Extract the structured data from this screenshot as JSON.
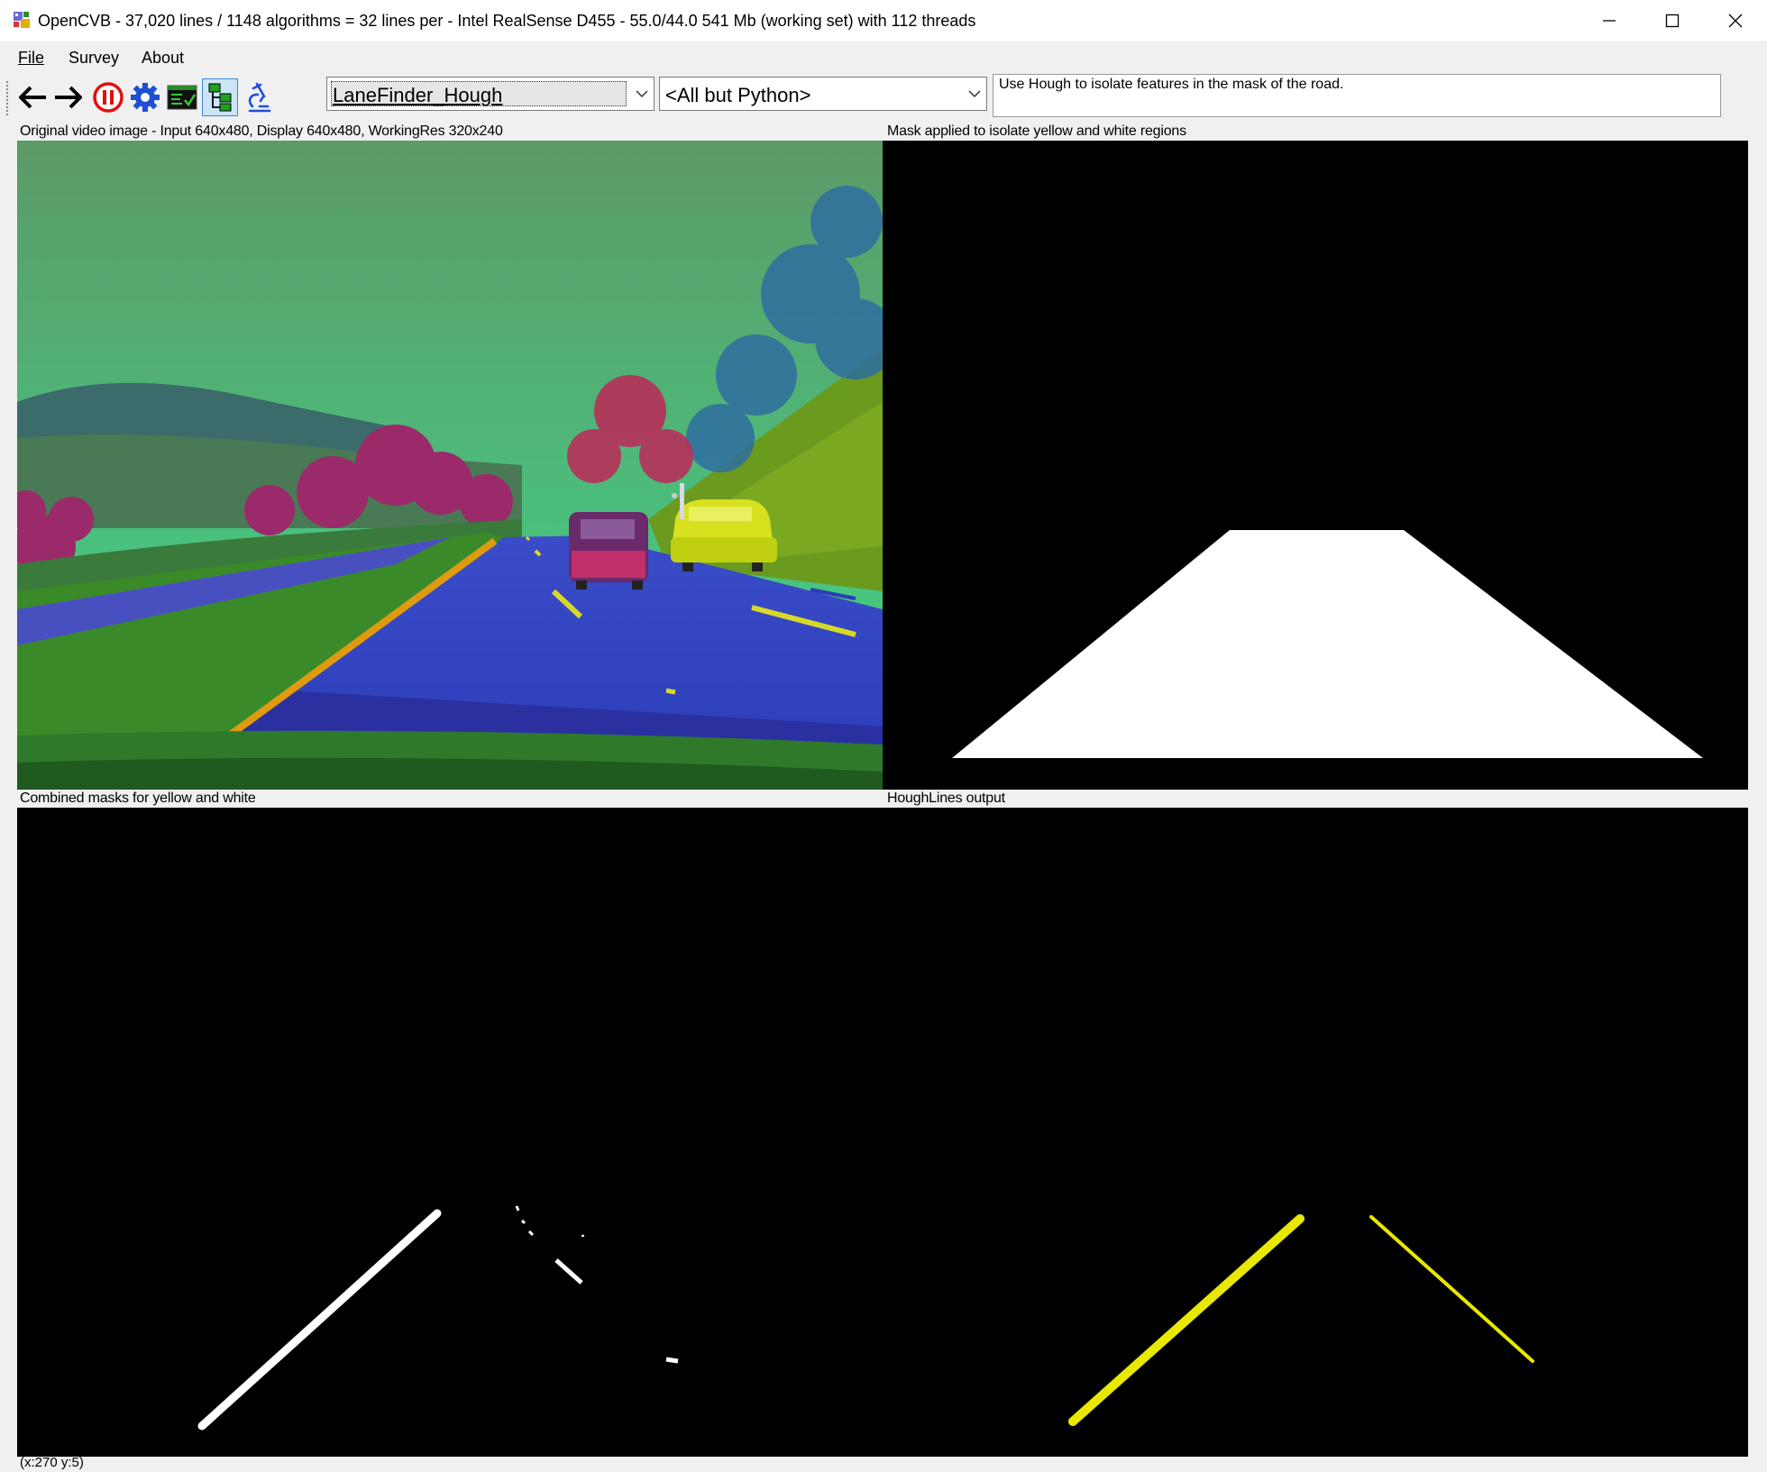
{
  "window": {
    "title": "OpenCVB - 37,020 lines / 1148 algorithms = 32 lines per - Intel RealSense D455 - 55.0/44.0 541 Mb (working set) with 112 threads"
  },
  "menu": {
    "file": "File",
    "survey": "Survey",
    "about": "About"
  },
  "toolbar": {
    "buttons": [
      "back-icon",
      "forward-icon",
      "pause-icon",
      "settings-gear-icon",
      "test-all-icon",
      "algorithm-tree-icon",
      "pixel-viewer-microscope-icon"
    ],
    "algorithm": "LaneFinder_Hough",
    "group": "<All but Python>",
    "description": "Use Hough to isolate features in the mask of the road."
  },
  "panels": {
    "top_left": {
      "label": "Original video image - Input 640x480, Display 640x480, WorkingRes 320x240"
    },
    "top_right": {
      "label": "Mask applied to isolate yellow and white regions"
    },
    "bottom_left": {
      "label": "Combined masks for yellow and white"
    },
    "bottom_right": {
      "label": "HoughLines output"
    }
  },
  "status": {
    "text": "(x:270 y:5)"
  },
  "colors": {
    "chrome": "#f0f0f0",
    "panel_bg": "#000000",
    "mask": "#ffffff",
    "hough_line": "#e8e800"
  }
}
